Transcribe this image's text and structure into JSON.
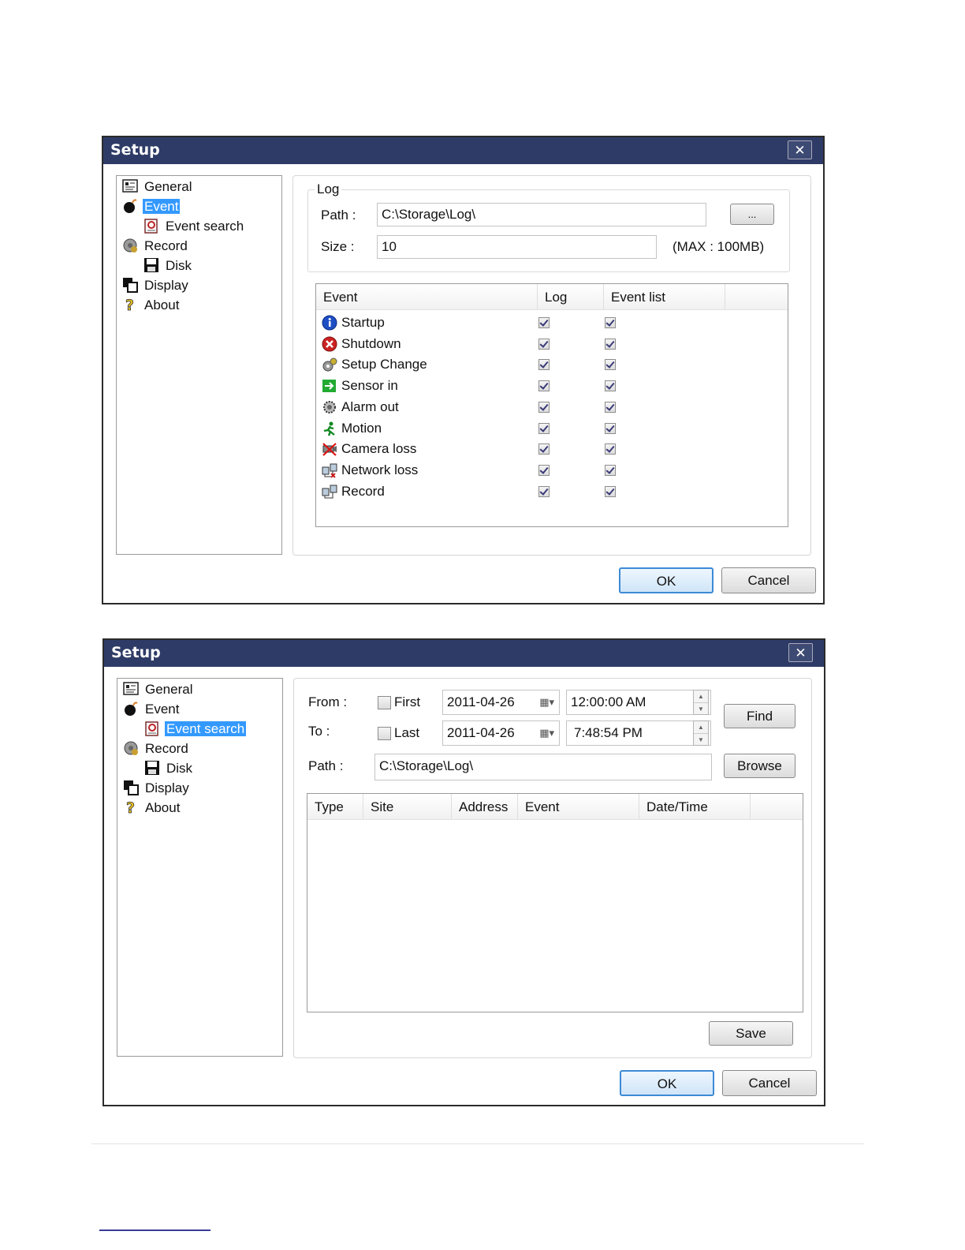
{
  "dialog1": {
    "title": "Setup",
    "close": "✕",
    "tree": [
      {
        "label": "General",
        "icon": "general-icon"
      },
      {
        "label": "Event",
        "icon": "event-icon"
      },
      {
        "label": "Event search",
        "icon": "event-search-icon"
      },
      {
        "label": "Record",
        "icon": "record-icon"
      },
      {
        "label": "Disk",
        "icon": "disk-icon"
      },
      {
        "label": "Display",
        "icon": "display-icon"
      },
      {
        "label": "About",
        "icon": "about-icon"
      }
    ],
    "selected": "Event",
    "log": {
      "legend": "Log",
      "path_label": "Path :",
      "path_value": "C:\\Storage\\Log\\",
      "browse_label": "...",
      "size_label": "Size :",
      "size_value": "10",
      "max_note": "(MAX : 100MB)"
    },
    "table": {
      "headers": [
        "Event",
        "Log",
        "Event list"
      ],
      "rows": [
        {
          "label": "Startup",
          "icon": "info-icon",
          "log": true,
          "list": true
        },
        {
          "label": "Shutdown",
          "icon": "shutdown-icon",
          "log": true,
          "list": true
        },
        {
          "label": "Setup Change",
          "icon": "setup-change-icon",
          "log": true,
          "list": true
        },
        {
          "label": "Sensor in",
          "icon": "sensor-in-icon",
          "log": true,
          "list": true
        },
        {
          "label": "Alarm out",
          "icon": "alarm-out-icon",
          "log": true,
          "list": true
        },
        {
          "label": "Motion",
          "icon": "motion-icon",
          "log": true,
          "list": true
        },
        {
          "label": "Camera loss",
          "icon": "camera-loss-icon",
          "log": true,
          "list": true
        },
        {
          "label": "Network loss",
          "icon": "network-loss-icon",
          "log": true,
          "list": true
        },
        {
          "label": "Record",
          "icon": "record-event-icon",
          "log": true,
          "list": true
        }
      ]
    },
    "ok": "OK",
    "cancel": "Cancel"
  },
  "dialog2": {
    "title": "Setup",
    "close": "✕",
    "tree": [
      {
        "label": "General",
        "icon": "general-icon"
      },
      {
        "label": "Event",
        "icon": "event-icon"
      },
      {
        "label": "Event search",
        "icon": "event-search-icon"
      },
      {
        "label": "Record",
        "icon": "record-icon"
      },
      {
        "label": "Disk",
        "icon": "disk-icon"
      },
      {
        "label": "Display",
        "icon": "display-icon"
      },
      {
        "label": "About",
        "icon": "about-icon"
      }
    ],
    "selected": "Event search",
    "search": {
      "from_label": "From :",
      "to_label": "To :",
      "first_label": "First",
      "first_checked": false,
      "last_label": "Last",
      "last_checked": false,
      "from_date": "2011-04-26",
      "from_time": "12:00:00 AM",
      "to_date": "2011-04-26",
      "to_time": "7:48:54 PM",
      "find": "Find",
      "path_label": "Path :",
      "path_value": "C:\\Storage\\Log\\",
      "browse": "Browse",
      "headers": [
        "Type",
        "Site",
        "Address",
        "Event",
        "Date/Time"
      ],
      "save": "Save"
    },
    "ok": "OK",
    "cancel": "Cancel"
  }
}
